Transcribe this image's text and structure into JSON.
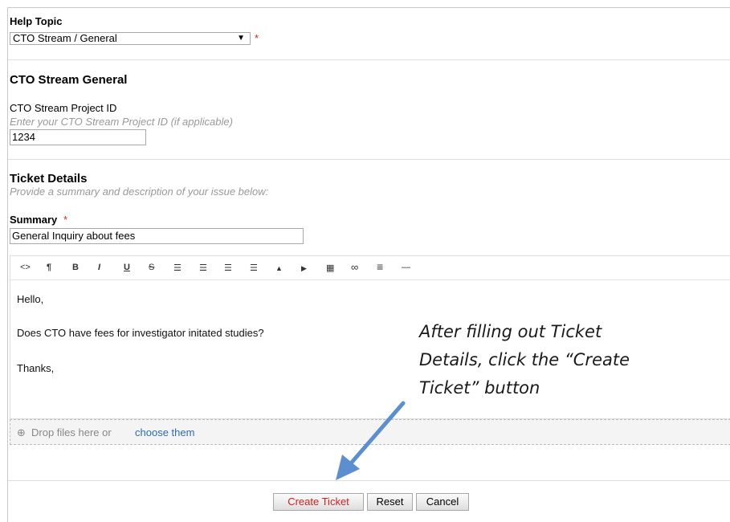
{
  "help_topic": {
    "label": "Help Topic",
    "selected": "CTO Stream / General",
    "required_mark": "*"
  },
  "cto_section": {
    "title": "CTO Stream General",
    "project_id_label": "CTO Stream Project ID",
    "project_id_hint": "Enter your CTO Stream Project ID (if applicable)",
    "project_id_value": "1234"
  },
  "ticket_details": {
    "title": "Ticket Details",
    "subtitle": "Provide a summary and description of your issue below:",
    "summary_label": "Summary",
    "required_mark": "*",
    "summary_value": "General Inquiry about fees"
  },
  "editor": {
    "toolbar": [
      {
        "glyph": "<>",
        "icon": "code-icon"
      },
      {
        "glyph": "¶",
        "icon": "paragraph-icon"
      },
      {
        "glyph": "B",
        "icon": "bold-icon"
      },
      {
        "glyph": "I",
        "icon": "italic-icon"
      },
      {
        "glyph": "U",
        "icon": "underline-icon"
      },
      {
        "glyph": "S",
        "icon": "strikethrough-icon"
      },
      {
        "glyph": "☰",
        "icon": "bullet-list-icon"
      },
      {
        "glyph": "☰",
        "icon": "numbered-list-icon"
      },
      {
        "glyph": "☰",
        "icon": "outdent-icon"
      },
      {
        "glyph": "☰",
        "icon": "indent-icon"
      },
      {
        "glyph": "▲",
        "icon": "image-icon"
      },
      {
        "glyph": "▶",
        "icon": "video-icon"
      },
      {
        "glyph": "▦",
        "icon": "table-icon"
      },
      {
        "glyph": "∞",
        "icon": "link-icon"
      },
      {
        "glyph": "≡",
        "icon": "align-icon"
      },
      {
        "glyph": "—",
        "icon": "horizontal-rule-icon"
      }
    ],
    "lines": [
      "Hello,",
      "Does CTO have fees for investigator initated studies?",
      "Thanks,"
    ]
  },
  "dropzone": {
    "icon": "upload-icon",
    "text": "Drop files here or",
    "link": "choose them"
  },
  "buttons": {
    "create": "Create Ticket",
    "reset": "Reset",
    "cancel": "Cancel"
  },
  "annotation": {
    "lines": [
      "After filling out Ticket",
      "Details, click the “Create",
      "Ticket” button"
    ],
    "arrow_color": "#5b8fcf"
  },
  "colors": {
    "required": "#e02020",
    "create_button_text": "#d02020",
    "link": "#2a6db5"
  }
}
